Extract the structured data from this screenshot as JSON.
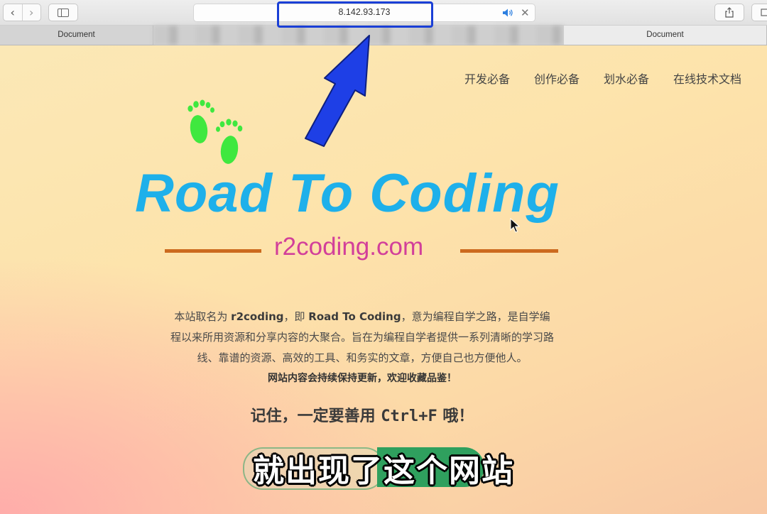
{
  "browser": {
    "url": "8.142.93.173",
    "tabs": [
      {
        "label": "Document",
        "state": "normal"
      },
      {
        "label": "",
        "state": "blurred"
      },
      {
        "label": "Document",
        "state": "active"
      }
    ]
  },
  "site": {
    "nav": [
      "开发必备",
      "创作必备",
      "划水必备",
      "在线技术文档"
    ],
    "logo_title": "Road To Coding",
    "logo_domain": "r2coding.com",
    "intro": {
      "p1_a": "本站取名为 ",
      "p1_b": "r2coding",
      "p1_c": "，即 ",
      "p1_d": "Road To Coding",
      "p1_e": "，意为编程自学之路，是自学编程以来所用资源和分享内容的大聚合。旨在为编程自学者提供一系列清晰的学习路线、靠谱的资源、高效的工具、和务实的文章，方便自己也方便他人。",
      "highlight": "网站内容会持续保持更新，欢迎收藏品鉴！"
    },
    "tip_a": "记住，一定要善用 ",
    "tip_b": "Ctrl+F",
    "tip_c": " 哦！"
  },
  "caption": "就出现了这个网站",
  "colors": {
    "logo_blue": "#1eb0ea",
    "domain_pink": "#d23f9a",
    "line_orange": "#cc6a1f",
    "annotation_blue": "#1a3fd6",
    "caption_green": "#2fa05e"
  },
  "icons": [
    "back-icon",
    "forward-icon",
    "sidebar-icon",
    "speaker-icon",
    "close-icon",
    "share-icon",
    "tabs-icon",
    "footprints-icon",
    "arrow-annotation-icon",
    "mouse-cursor-icon"
  ]
}
